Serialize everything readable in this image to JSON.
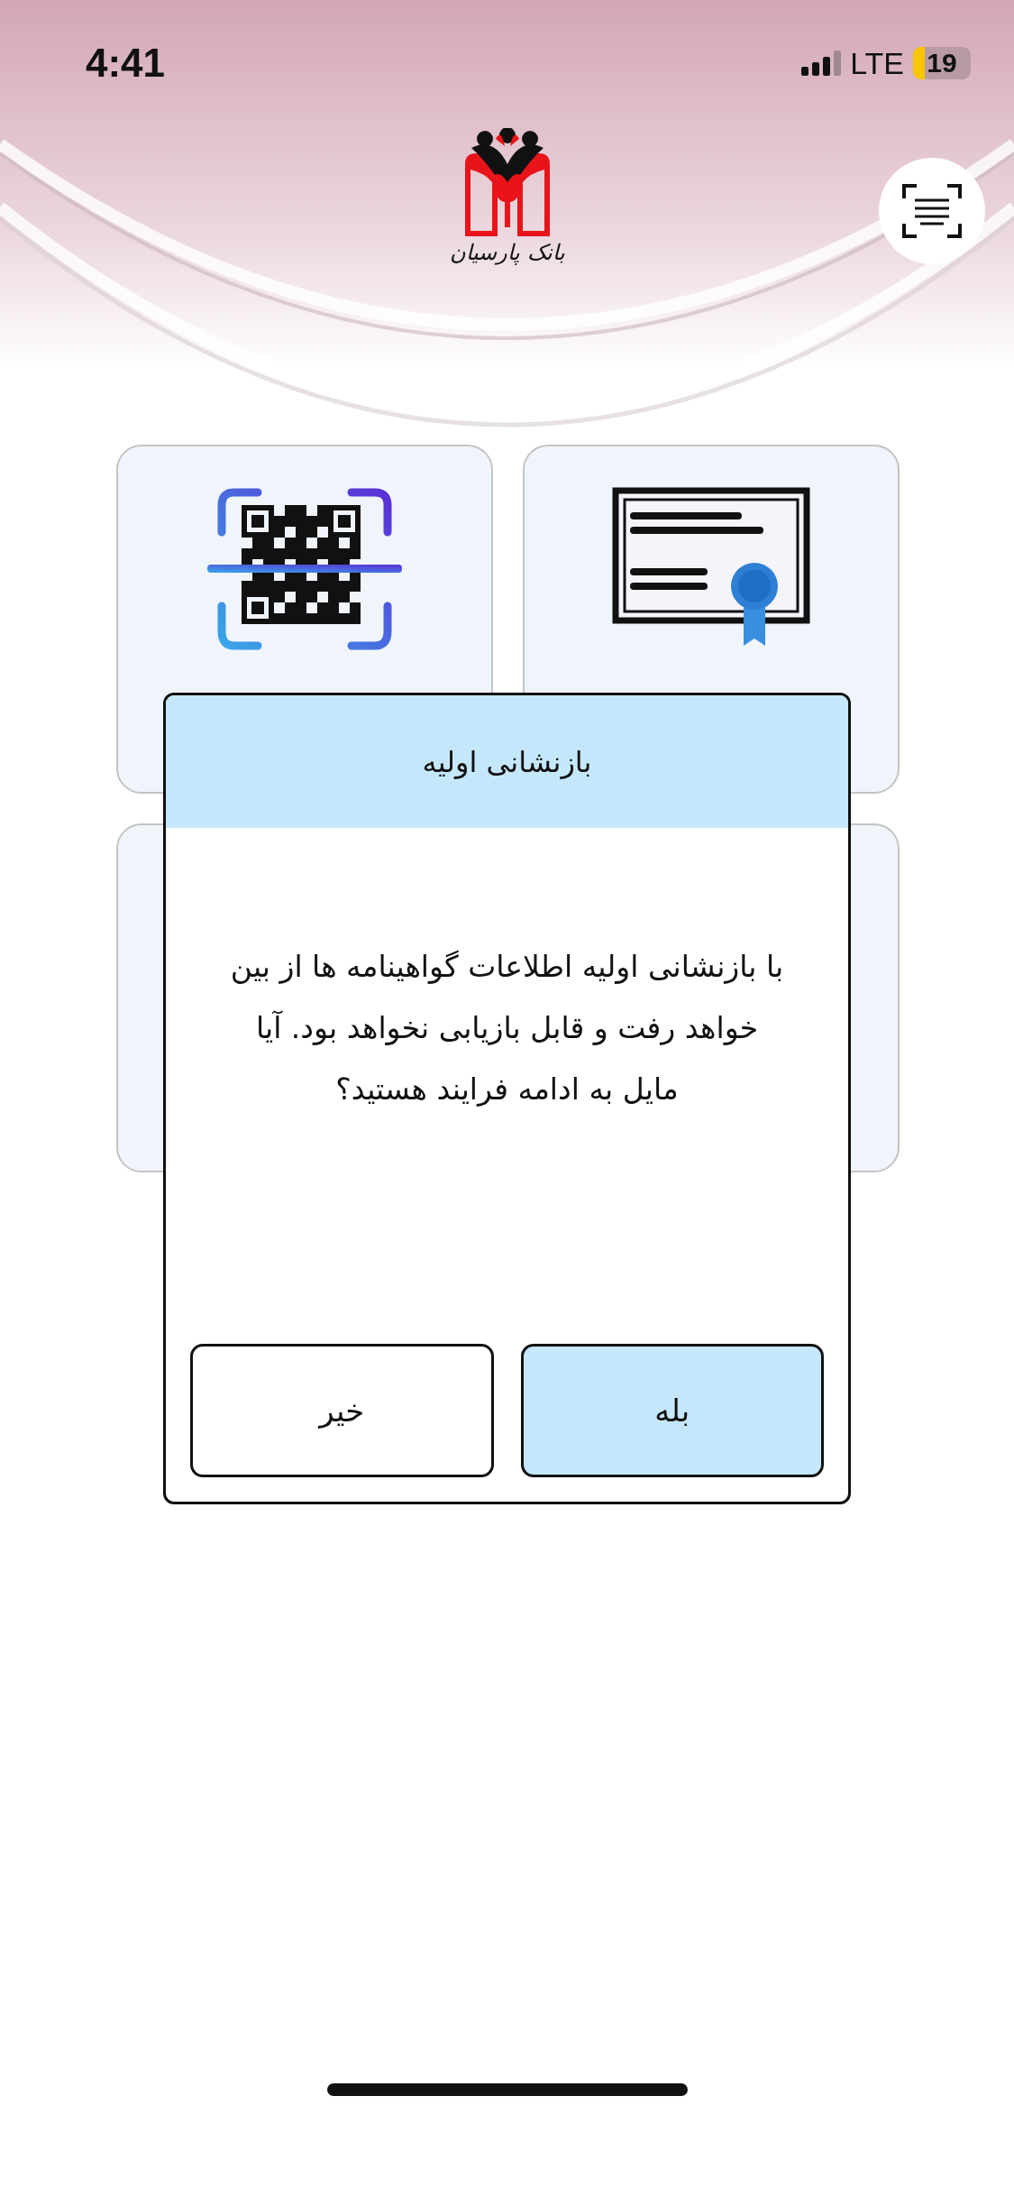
{
  "status_bar": {
    "time": "4:41",
    "network": "LTE",
    "battery": "19"
  },
  "logo": {
    "text": "بانک پارسیان"
  },
  "cards": [
    {
      "kind": "qr"
    },
    {
      "kind": "certificate"
    },
    {
      "kind": "empty"
    },
    {
      "kind": "empty"
    }
  ],
  "dialog": {
    "title": "بازنشانی اولیه",
    "message": "با بازنشانی اولیه اطلاعات گواهینامه ها از بین خواهد رفت و قابل بازیابی نخواهد بود. آیا مایل به ادامه فرایند هستید؟",
    "buttons": [
      {
        "label": "بله",
        "kind": "primary"
      },
      {
        "label": "خیر",
        "kind": "secondary"
      }
    ]
  }
}
